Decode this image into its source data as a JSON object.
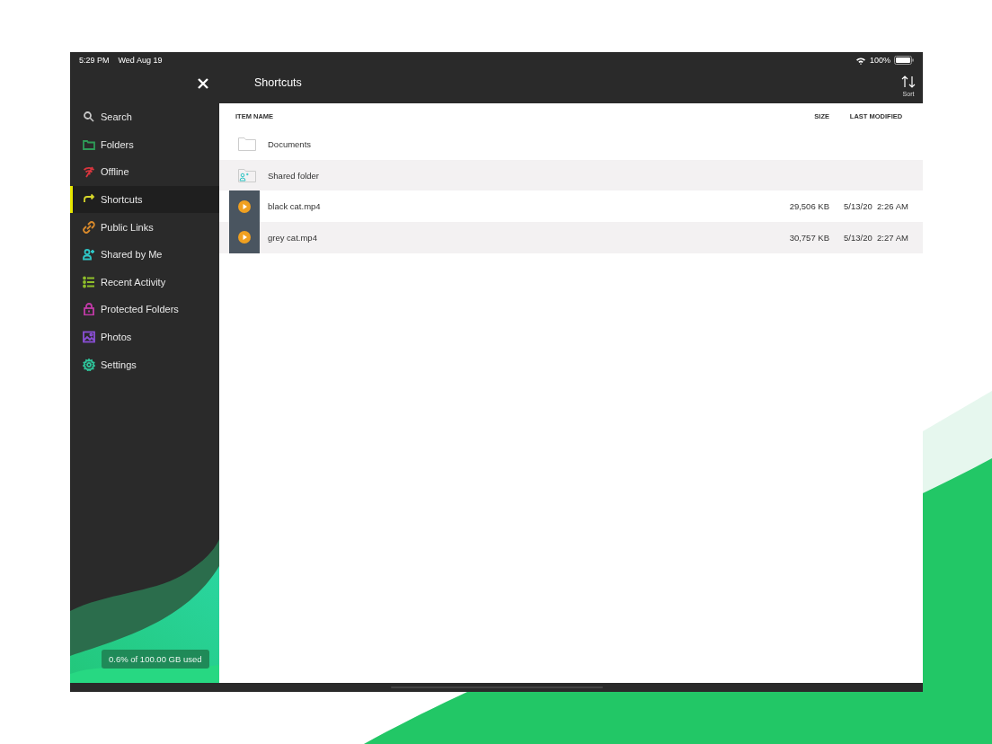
{
  "status_bar": {
    "time": "5:29 PM",
    "date": "Wed Aug 19",
    "battery": "100%"
  },
  "header": {
    "title": "Shortcuts",
    "sort_label": "Sort"
  },
  "sidebar": {
    "items": [
      {
        "label": "Search",
        "kind": "search",
        "color": "#c8c8c8",
        "selected": false
      },
      {
        "label": "Folders",
        "kind": "folder",
        "color": "#2e9b57",
        "selected": false
      },
      {
        "label": "Offline",
        "kind": "offline",
        "color": "#d9363e",
        "selected": false
      },
      {
        "label": "Shortcuts",
        "kind": "shortcut",
        "color": "#d6d62a",
        "selected": true
      },
      {
        "label": "Public Links",
        "kind": "link",
        "color": "#d98a2b",
        "selected": false
      },
      {
        "label": "Shared by Me",
        "kind": "share",
        "color": "#2ec4c4",
        "selected": false
      },
      {
        "label": "Recent Activity",
        "kind": "list",
        "color": "#8fbf2a",
        "selected": false
      },
      {
        "label": "Protected Folders",
        "kind": "lock",
        "color": "#c23aa8",
        "selected": false
      },
      {
        "label": "Photos",
        "kind": "photo",
        "color": "#8a4fd6",
        "selected": false
      },
      {
        "label": "Settings",
        "kind": "gear",
        "color": "#2ec49a",
        "selected": false
      }
    ],
    "storage": "0.6% of 100.00 GB used"
  },
  "table": {
    "columns": [
      "ITEM NAME",
      "SIZE",
      "LAST MODIFIED"
    ],
    "rows": [
      {
        "kind": "folder",
        "name": "Documents"
      },
      {
        "kind": "shared_folder",
        "name": "Shared folder"
      },
      {
        "kind": "video",
        "name": "black cat.mp4",
        "size": "29,506 KB",
        "modified": "5/13/20  2:26 AM"
      },
      {
        "kind": "video",
        "name": "grey cat.mp4",
        "size": "30,757 KB",
        "modified": "5/13/20  2:27 AM"
      }
    ]
  }
}
